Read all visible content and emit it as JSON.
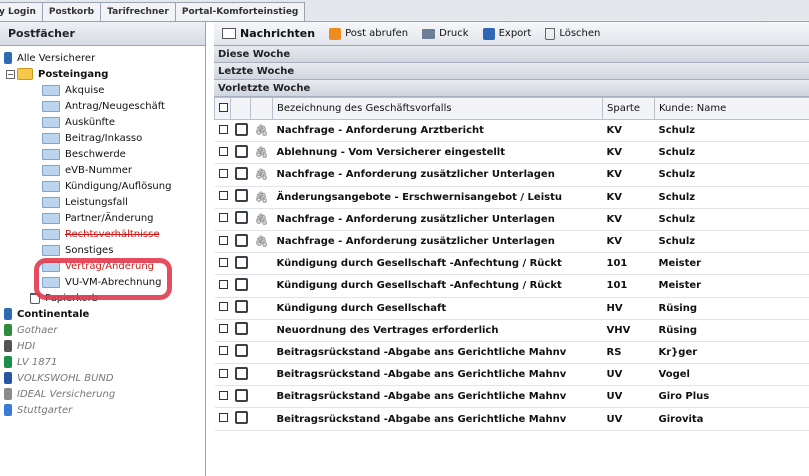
{
  "topnav": {
    "tabs": [
      "y Login",
      "Postkorb",
      "Tarifrechner",
      "Portal-Komforteinstieg"
    ]
  },
  "left": {
    "title": "Postfächer",
    "items": [
      {
        "label": "Alle Versicherer",
        "level": 0,
        "style": "normal"
      },
      {
        "label": "Posteingang",
        "level": 1,
        "style": "bold"
      },
      {
        "label": "Akquise",
        "level": 2,
        "style": "normal"
      },
      {
        "label": "Antrag/Neugeschäft",
        "level": 2,
        "style": "normal"
      },
      {
        "label": "Auskünfte",
        "level": 2,
        "style": "normal"
      },
      {
        "label": "Beitrag/Inkasso",
        "level": 2,
        "style": "normal"
      },
      {
        "label": "Beschwerde",
        "level": 2,
        "style": "normal"
      },
      {
        "label": "eVB-Nummer",
        "level": 2,
        "style": "normal"
      },
      {
        "label": "Kündigung/Auflösung",
        "level": 2,
        "style": "normal"
      },
      {
        "label": "Leistungsfall",
        "level": 2,
        "style": "normal"
      },
      {
        "label": "Partner/Änderung",
        "level": 2,
        "style": "normal"
      },
      {
        "label": "Rechtsverhältnisse",
        "level": 2,
        "style": "red"
      },
      {
        "label": "Sonstiges",
        "level": 2,
        "style": "normal"
      },
      {
        "label": "Vertrag/Änderung",
        "level": 2,
        "style": "red"
      },
      {
        "label": "VU-VM-Abrechnung",
        "level": 2,
        "style": "normal"
      },
      {
        "label": "Papierkorb",
        "level": 3,
        "style": "normal"
      },
      {
        "label": "Continentale",
        "level": 0,
        "style": "bold"
      },
      {
        "label": "Gothaer",
        "level": 0,
        "style": "grey"
      },
      {
        "label": "HDI",
        "level": 0,
        "style": "grey"
      },
      {
        "label": "LV 1871",
        "level": 0,
        "style": "grey"
      },
      {
        "label": "VOLKSWOHL BUND",
        "level": 0,
        "style": "grey"
      },
      {
        "label": "IDEAL Versicherung",
        "level": 0,
        "style": "grey"
      },
      {
        "label": "Stuttgarter",
        "level": 0,
        "style": "grey"
      }
    ],
    "insurer_colors": [
      "#2b6cb0",
      "#2e8b3d",
      "#555555",
      "#1a8f4a",
      "#2a55a0",
      "#8a8a8a",
      "#3a7bd5"
    ]
  },
  "toolbar": {
    "messages": "Nachrichten",
    "fetch": "Post abrufen",
    "print": "Druck",
    "export": "Export",
    "delete": "Löschen"
  },
  "groups": {
    "this_week": "Diese Woche",
    "last_week": "Letzte Woche",
    "week_before": "Vorletzte Woche"
  },
  "table": {
    "headers": {
      "subject": "Bezeichnung des Geschäftsvorfalls",
      "sparte": "Sparte",
      "customer": "Kunde: Name"
    },
    "rows": [
      {
        "attach": "🖇",
        "subject": "Nachfrage - Anforderung Arztbericht",
        "sparte": "KV",
        "customer": "Schulz"
      },
      {
        "attach": "🖇",
        "subject": "Ablehnung - Vom Versicherer eingestellt",
        "sparte": "KV",
        "customer": "Schulz"
      },
      {
        "attach": "🖇",
        "subject": "Nachfrage - Anforderung zusätzlicher Unterlagen",
        "sparte": "KV",
        "customer": "Schulz"
      },
      {
        "attach": "🖇",
        "subject": "Änderungsangebote - Erschwernisangebot / Leistu",
        "sparte": "KV",
        "customer": "Schulz"
      },
      {
        "attach": "🖇",
        "subject": "Nachfrage - Anforderung zusätzlicher Unterlagen",
        "sparte": "KV",
        "customer": "Schulz"
      },
      {
        "attach": "🖇",
        "subject": "Nachfrage - Anforderung zusätzlicher Unterlagen",
        "sparte": "KV",
        "customer": "Schulz"
      },
      {
        "attach": "",
        "subject": "Kündigung durch Gesellschaft -Anfechtung / Rückt",
        "sparte": "101",
        "customer": "Meister"
      },
      {
        "attach": "",
        "subject": "Kündigung durch Gesellschaft -Anfechtung / Rückt",
        "sparte": "101",
        "customer": "Meister"
      },
      {
        "attach": "",
        "subject": "Kündigung durch Gesellschaft",
        "sparte": "HV",
        "customer": "Rüsing"
      },
      {
        "attach": "",
        "subject": "Neuordnung des Vertrages erforderlich",
        "sparte": "VHV",
        "customer": "Rüsing"
      },
      {
        "attach": "",
        "subject": "Beitragsrückstand -Abgabe ans Gerichtliche Mahnv",
        "sparte": "RS",
        "customer": "Kr}ger"
      },
      {
        "attach": "",
        "subject": "Beitragsrückstand -Abgabe ans Gerichtliche Mahnv",
        "sparte": "UV",
        "customer": "Vogel"
      },
      {
        "attach": "",
        "subject": "Beitragsrückstand -Abgabe ans Gerichtliche Mahnv",
        "sparte": "UV",
        "customer": "Giro Plus"
      },
      {
        "attach": "",
        "subject": "Beitragsrückstand -Abgabe ans Gerichtliche Mahnv",
        "sparte": "UV",
        "customer": "Girovita"
      }
    ]
  },
  "colors": {
    "highlight": "#e2394c",
    "red_item": "#cc1a1a"
  }
}
